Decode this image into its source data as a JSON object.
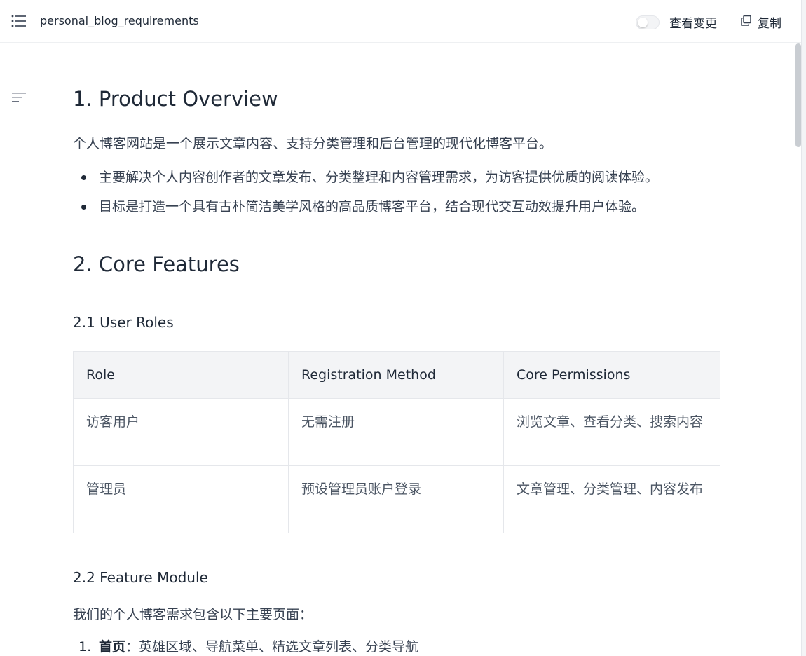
{
  "header": {
    "title": "personal_blog_requirements",
    "toggle_label": "查看变更",
    "toggle_on": false,
    "copy_label": "复制",
    "menu_icon": "list-icon",
    "copy_icon": "copy-icon"
  },
  "sidebar": {
    "outline_icon": "outline-icon"
  },
  "doc": {
    "sections": [
      {
        "heading": "1. Product Overview",
        "intro": "个人博客网站是一个展示文章内容、支持分类管理和后台管理的现代化博客平台。",
        "bullets": [
          "主要解决个人内容创作者的文章发布、分类整理和内容管理需求，为访客提供优质的阅读体验。",
          "目标是打造一个具有古朴简洁美学风格的高品质博客平台，结合现代交互动效提升用户体验。"
        ]
      },
      {
        "heading": "2. Core Features",
        "subsections": [
          {
            "heading": "2.1 User Roles",
            "table": {
              "headers": [
                "Role",
                "Registration Method",
                "Core Permissions"
              ],
              "rows": [
                [
                  "访客用户",
                  "无需注册",
                  "浏览文章、查看分类、搜索内容"
                ],
                [
                  "管理员",
                  "预设管理员账户登录",
                  "文章管理、分类管理、内容发布"
                ]
              ]
            }
          },
          {
            "heading": "2.2 Feature Module",
            "intro": "我们的个人博客需求包含以下主要页面：",
            "items": [
              {
                "num": "1.",
                "title": "首页",
                "text": "：英雄区域、导航菜单、精选文章列表、分类导航"
              }
            ]
          }
        ]
      }
    ]
  }
}
